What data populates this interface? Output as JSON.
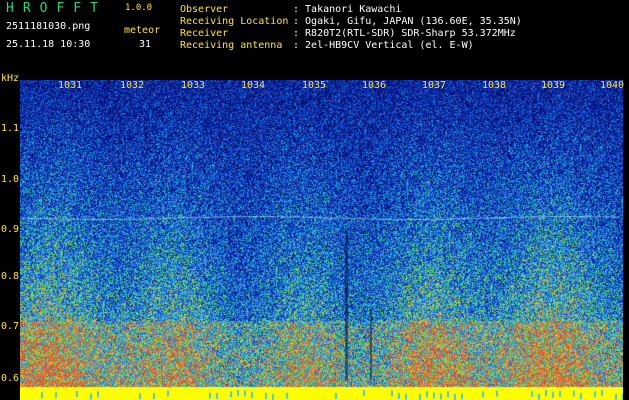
{
  "header": {
    "logo": "HROFFT",
    "version": "1.0.0",
    "filename": "2511181030.png",
    "timestamp": "25.11.18 10:30",
    "meteor_label": "meteor",
    "meteor_count": "31"
  },
  "info": [
    {
      "label": "Observer",
      "value": ": Takanori Kawachi"
    },
    {
      "label": "Receiving Location",
      "value": ": Ogaki, Gifu, JAPAN (136.60E, 35.35N)"
    },
    {
      "label": "Receiver",
      "value": ": R820T2(RTL-SDR) SDR-Sharp 53.372MHz"
    },
    {
      "label": "Receiving antenna",
      "value": ": 2el-HB9CV Vertical (el. E-W)"
    }
  ],
  "axis": {
    "unit": "kHz",
    "x_ticks": [
      "1031",
      "1032",
      "1033",
      "1034",
      "1035",
      "1036",
      "1037",
      "1038",
      "1039",
      "1040"
    ],
    "y_ticks": [
      "1.1",
      "1.0",
      "0.9",
      "0.8",
      "0.7",
      "0.6"
    ]
  },
  "colors": {
    "background": "#000000",
    "label_yellow": "#ffe24a",
    "logo_green": "#2fd07a",
    "spectrum_base": "#0a1e8c",
    "baseline_yellow": "#ffff00"
  }
}
